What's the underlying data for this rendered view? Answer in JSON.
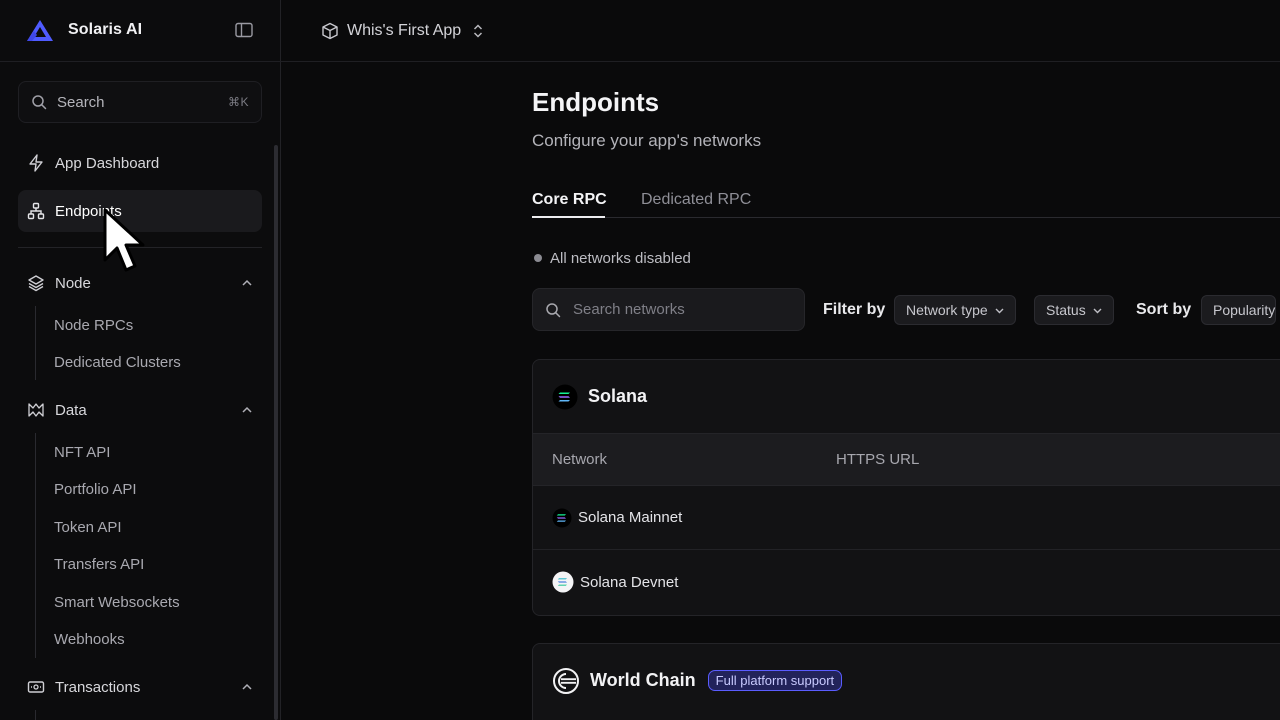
{
  "brand": {
    "name": "Solaris AI"
  },
  "topbar": {
    "app_name": "Whis's First App"
  },
  "sidebar": {
    "search_label": "Search",
    "search_shortcut": "⌘K",
    "items": [
      {
        "label": "App Dashboard",
        "icon": "bolt-icon"
      },
      {
        "label": "Endpoints",
        "icon": "network-icon",
        "active": true
      }
    ],
    "groups": [
      {
        "label": "Node",
        "icon": "layers-icon",
        "expanded": true,
        "children": [
          "Node RPCs",
          "Dedicated Clusters"
        ]
      },
      {
        "label": "Data",
        "icon": "data-icon",
        "expanded": true,
        "children": [
          "NFT API",
          "Portfolio API",
          "Token API",
          "Transfers API",
          "Smart Websockets",
          "Webhooks"
        ]
      },
      {
        "label": "Transactions",
        "icon": "ticket-icon",
        "expanded": true,
        "children": []
      }
    ]
  },
  "main": {
    "title": "Endpoints",
    "subtitle": "Configure your app's networks",
    "tabs": [
      {
        "label": "Core RPC",
        "active": true
      },
      {
        "label": "Dedicated RPC",
        "active": false
      }
    ],
    "status_text": "All networks disabled",
    "search_placeholder": "Search networks",
    "filter_label": "Filter by",
    "filters": [
      "Network type",
      "Status"
    ],
    "sort_label": "Sort by",
    "sort_value": "Popularity",
    "cards": [
      {
        "name": "Solana",
        "columns": [
          "Network",
          "HTTPS URL"
        ],
        "rows": [
          "Solana Mainnet",
          "Solana Devnet"
        ]
      },
      {
        "name": "World Chain",
        "badge": "Full platform support"
      }
    ]
  },
  "colors": {
    "accent": "#4f46e5",
    "badge_border": "#5a5cff",
    "background": "#0a0a0b"
  }
}
